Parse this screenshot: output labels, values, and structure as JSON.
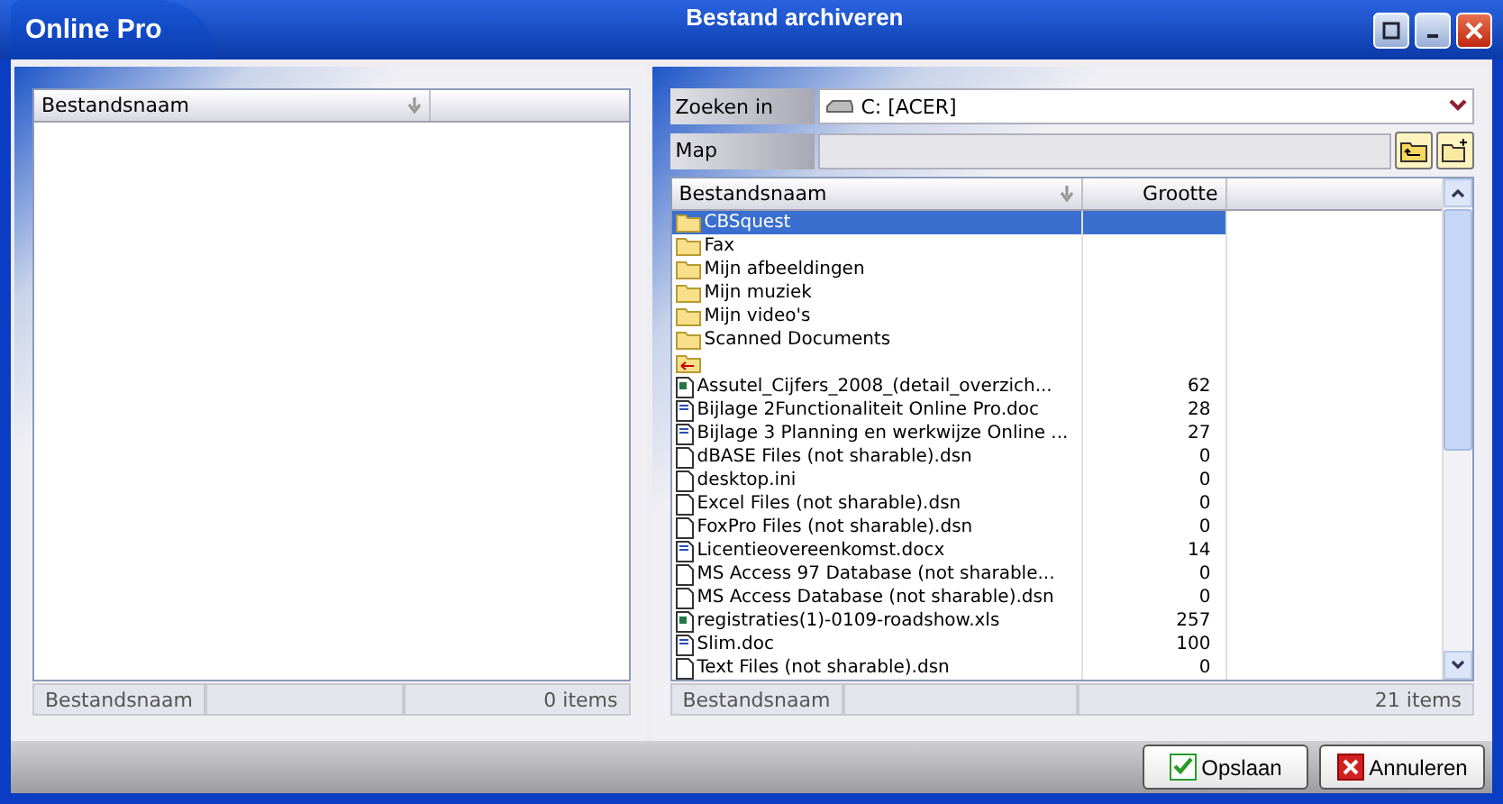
{
  "window": {
    "app_name": "Online Pro",
    "title": "Bestand archiveren"
  },
  "left_panel": {
    "columns": [
      "Bestandsnaam"
    ],
    "status": {
      "label": "Bestandsnaam",
      "count": "0 items"
    }
  },
  "right_panel": {
    "look_in": {
      "label": "Zoeken in",
      "value": "C: [ACER]"
    },
    "folder": {
      "label": "Map"
    },
    "columns": [
      "Bestandsnaam",
      "Grootte"
    ],
    "rows": [
      {
        "kind": "folder",
        "name": "CBSquest",
        "size": "",
        "selected": true
      },
      {
        "kind": "folder",
        "name": "Fax",
        "size": "",
        "selected": false
      },
      {
        "kind": "folder",
        "name": "Mijn afbeeldingen",
        "size": "",
        "selected": false
      },
      {
        "kind": "folder",
        "name": "Mijn muziek",
        "size": "",
        "selected": false
      },
      {
        "kind": "folder",
        "name": "Mijn video's",
        "size": "",
        "selected": false
      },
      {
        "kind": "folder",
        "name": "Scanned Documents",
        "size": "",
        "selected": false
      },
      {
        "kind": "up",
        "name": "",
        "size": "",
        "selected": false
      },
      {
        "kind": "sheet",
        "name": "Assutel_Cijfers_2008_(detail_overzich...",
        "size": "62",
        "selected": false
      },
      {
        "kind": "doc",
        "name": "Bijlage 2Functionaliteit Online Pro.doc",
        "size": "28",
        "selected": false
      },
      {
        "kind": "doc",
        "name": "Bijlage 3 Planning en werkwijze Online ...",
        "size": "27",
        "selected": false
      },
      {
        "kind": "file",
        "name": "dBASE Files (not sharable).dsn",
        "size": "0",
        "selected": false
      },
      {
        "kind": "file",
        "name": "desktop.ini",
        "size": "0",
        "selected": false
      },
      {
        "kind": "file",
        "name": "Excel Files (not sharable).dsn",
        "size": "0",
        "selected": false
      },
      {
        "kind": "file",
        "name": "FoxPro Files (not sharable).dsn",
        "size": "0",
        "selected": false
      },
      {
        "kind": "doc",
        "name": "Licentieovereenkomst.docx",
        "size": "14",
        "selected": false
      },
      {
        "kind": "file",
        "name": "MS Access 97 Database (not sharable...",
        "size": "0",
        "selected": false
      },
      {
        "kind": "file",
        "name": "MS Access Database (not sharable).dsn",
        "size": "0",
        "selected": false
      },
      {
        "kind": "sheet",
        "name": "registraties(1)-0109-roadshow.xls",
        "size": "257",
        "selected": false
      },
      {
        "kind": "doc",
        "name": "Slim.doc",
        "size": "100",
        "selected": false
      },
      {
        "kind": "file",
        "name": "Text Files (not sharable).dsn",
        "size": "0",
        "selected": false
      }
    ],
    "status": {
      "label": "Bestandsnaam",
      "count": "21 items"
    }
  },
  "buttons": [
    {
      "kind": "ok",
      "label": "Opslaan"
    },
    {
      "kind": "cancel",
      "label": "Annuleren"
    }
  ]
}
